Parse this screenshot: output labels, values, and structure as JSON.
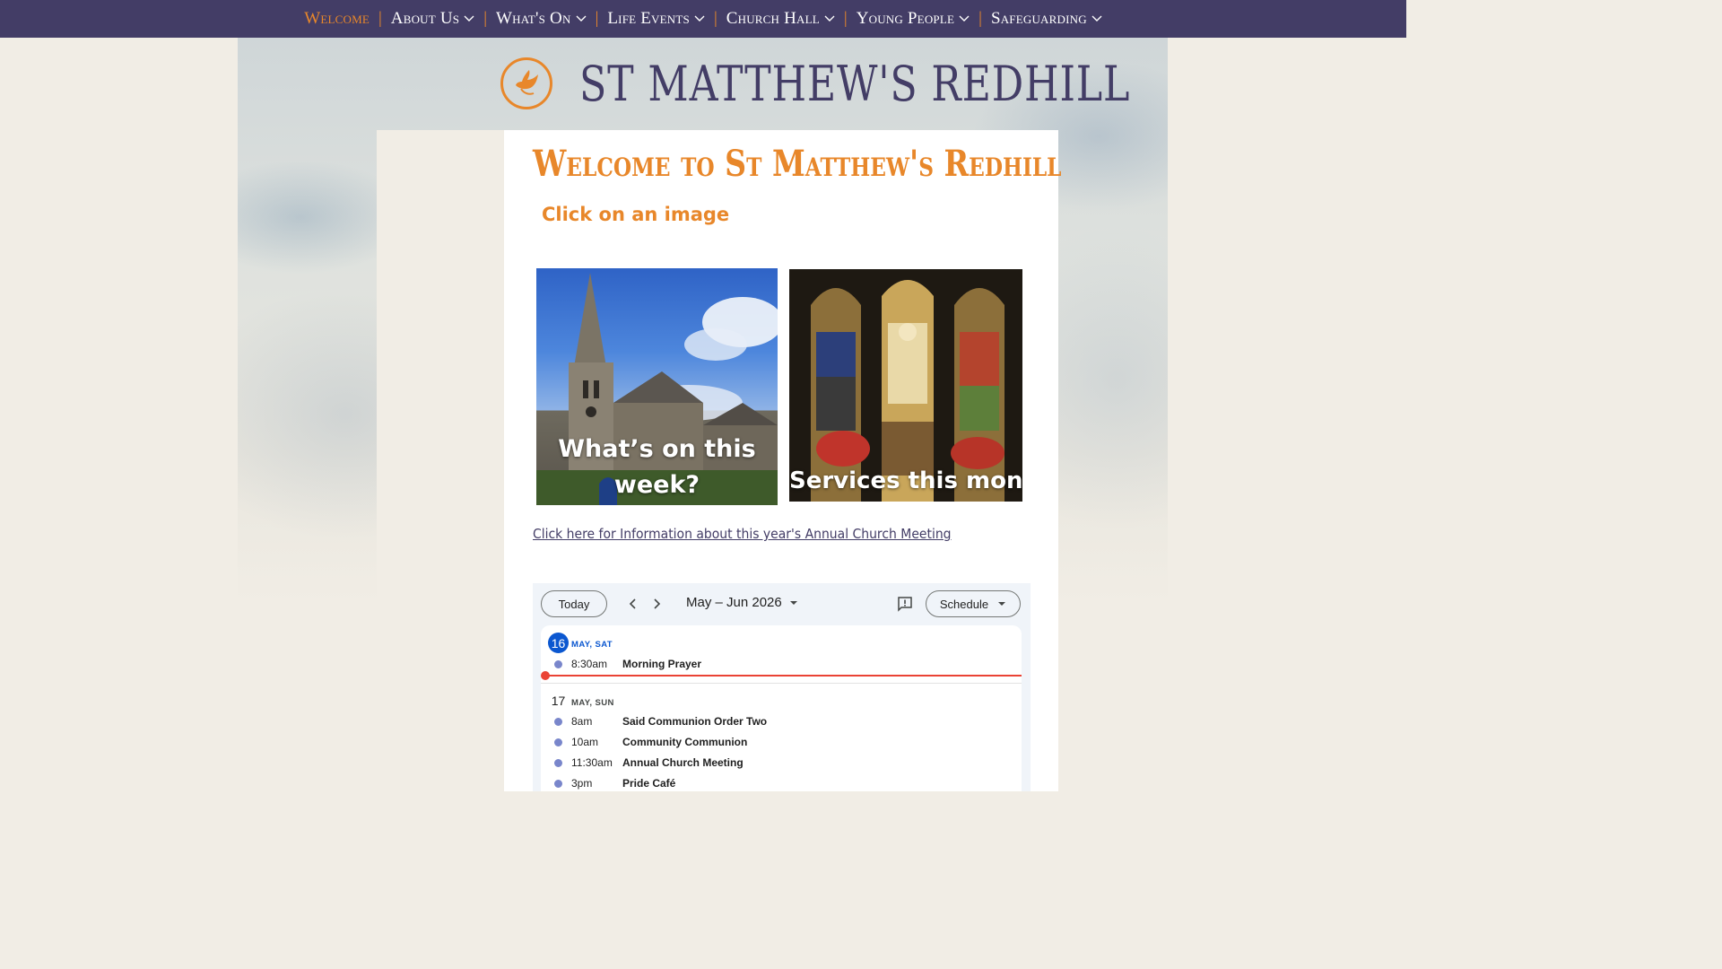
{
  "nav": {
    "items": [
      {
        "label": "Welcome",
        "active": true,
        "dropdown": false
      },
      {
        "label": "About Us",
        "active": false,
        "dropdown": true
      },
      {
        "label": "What's On",
        "active": false,
        "dropdown": true
      },
      {
        "label": "Life Events",
        "active": false,
        "dropdown": true
      },
      {
        "label": "Church Hall",
        "active": false,
        "dropdown": true
      },
      {
        "label": "Young People",
        "active": false,
        "dropdown": true
      },
      {
        "label": "Safeguarding",
        "active": false,
        "dropdown": true
      }
    ],
    "separator": "|"
  },
  "site": {
    "title": "ST MATTHEW'S REDHILL",
    "logo_icon": "dove-icon"
  },
  "main": {
    "heading": "Welcome to St Matthew's Redhill",
    "subheading": "Click on an image",
    "tiles": [
      {
        "caption": "What’s on this week?",
        "image": "church-exterior-photo"
      },
      {
        "caption": "Services this month",
        "image": "stained-glass-window-photo"
      }
    ],
    "meeting_link": "Click here for Information about this year's Annual Church Meeting "
  },
  "calendar": {
    "today_label": "Today",
    "range_label": "May – Jun 2026",
    "view_label": "Schedule",
    "days": [
      {
        "day_number": "16",
        "day_label": "May, Sat",
        "is_today": true,
        "events": [
          {
            "time": "8:30am",
            "title": "Morning Prayer"
          }
        ]
      },
      {
        "day_number": "17",
        "day_label": "May, Sun",
        "is_today": false,
        "events": [
          {
            "time": "8am",
            "title": "Said Communion Order Two"
          },
          {
            "time": "10am",
            "title": "Community Communion"
          },
          {
            "time": "11:30am",
            "title": "Annual Church Meeting"
          },
          {
            "time": "3pm",
            "title": "Pride Café"
          }
        ]
      }
    ]
  },
  "colors": {
    "nav_bg": "#433d66",
    "accent_orange": "#e8872a",
    "today_blue": "#0b57d0",
    "event_dot": "#7986cb",
    "now_line": "#ea4335"
  }
}
